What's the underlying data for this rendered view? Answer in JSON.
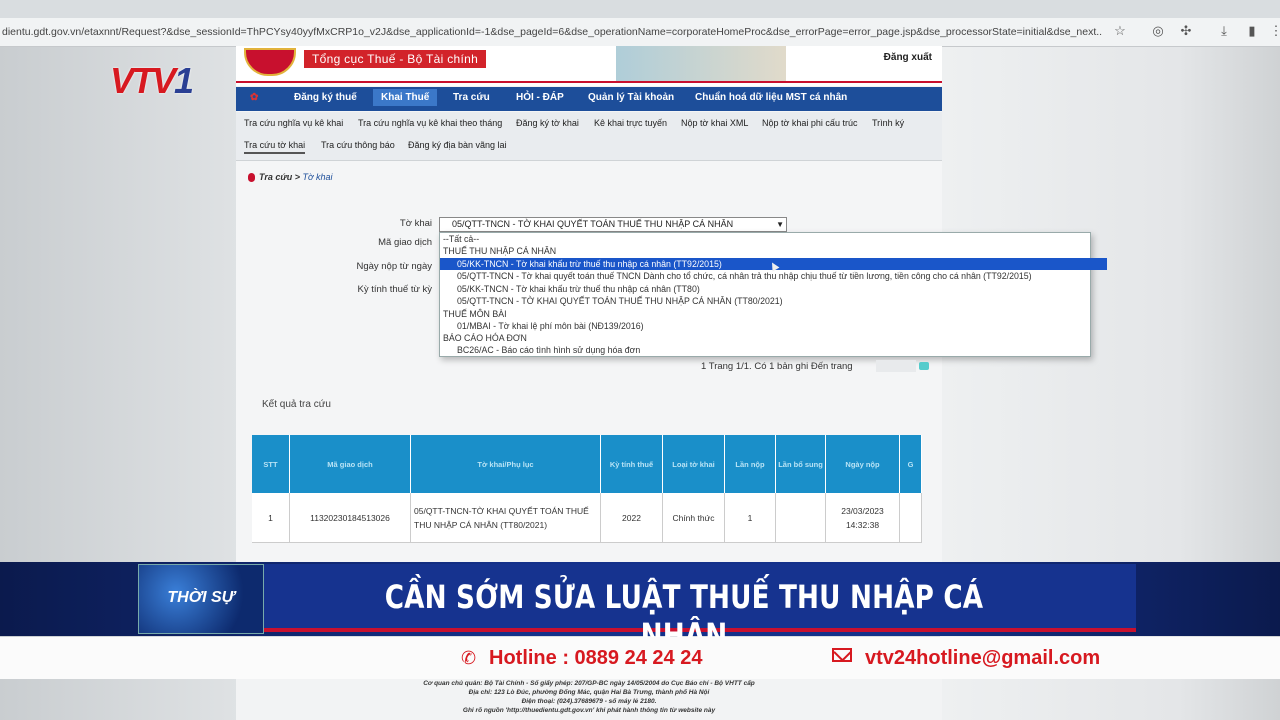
{
  "browser": {
    "url": "dientu.gdt.gov.vn/etaxnnt/Request?&dse_sessionId=ThPCYsy40yyfMxCRP1o_v2J&dse_applicationId=-1&dse_pageId=6&dse_operationName=corporateHomeProc&dse_errorPage=error_page.jsp&dse_processorState=initial&dse_next..."
  },
  "site": {
    "org_name": "Tổng cục Thuế - Bộ Tài chính",
    "logout": "Đăng xuất"
  },
  "nav": {
    "items": [
      {
        "label": "Đăng ký thuế"
      },
      {
        "label": "Khai Thuế"
      },
      {
        "label": "Tra cứu"
      },
      {
        "label": "HỎI - ĐÁP"
      },
      {
        "label": "Quản lý Tài khoản"
      },
      {
        "label": "Chuẩn hoá dữ liệu MST cá nhân"
      }
    ]
  },
  "subnav": {
    "items": [
      {
        "label": "Tra cứu nghĩa vụ kê khai"
      },
      {
        "label": "Tra cứu nghĩa vụ kê khai theo tháng"
      },
      {
        "label": "Đăng ký tờ khai"
      },
      {
        "label": "Kê khai trực tuyến"
      },
      {
        "label": "Nộp tờ khai XML"
      },
      {
        "label": "Nộp tờ khai phi cấu trúc"
      },
      {
        "label": "Trình ký"
      },
      {
        "label": "Tra cứu tờ khai"
      },
      {
        "label": "Tra cứu thông báo"
      },
      {
        "label": "Đăng ký địa bàn vãng lai"
      }
    ]
  },
  "breadcrumb": {
    "root": "Tra cứu",
    "sep": " > ",
    "current": "Tờ khai"
  },
  "form": {
    "labels": {
      "to_khai": "Tờ khai",
      "ma_giao_dich": "Mã giao dịch",
      "ngay_nop": "Ngày nộp từ ngày",
      "ky_tinh_thue": "Kỳ tính thuế từ kỳ"
    },
    "selected": "05/QTT-TNCN - TỜ KHAI QUYẾT TOÁN THUẾ THU NHẬP CÁ NHÂN",
    "options": [
      {
        "text": "--Tất cả--",
        "kind": "grp"
      },
      {
        "text": "THUẾ THU NHẬP CÁ NHÂN",
        "kind": "grp"
      },
      {
        "text": "05/KK-TNCN - Tờ khai khấu trừ thuế thu nhập cá nhân (TT92/2015)",
        "kind": "sel"
      },
      {
        "text": "05/QTT-TNCN - Tờ khai quyết toán thuế TNCN Dành cho tổ chức, cá nhân trả thu nhập chịu thuế từ tiền lương, tiền công cho cá nhân (TT92/2015)",
        "kind": "opt"
      },
      {
        "text": "05/KK-TNCN - Tờ khai khấu trừ thuế thu nhập cá nhân (TT80)",
        "kind": "opt"
      },
      {
        "text": "05/QTT-TNCN - TỜ KHAI QUYẾT TOÁN THUẾ THU NHẬP CÁ NHÂN (TT80/2021)",
        "kind": "opt"
      },
      {
        "text": "THUẾ MÔN BÀI",
        "kind": "grp"
      },
      {
        "text": "01/MBAI - Tờ khai lệ phí môn bài (NĐ139/2016)",
        "kind": "opt"
      },
      {
        "text": "BÁO CÁO HÓA ĐƠN",
        "kind": "grp"
      },
      {
        "text": "BC26/AC - Báo cáo tình hình sử dụng hóa đơn",
        "kind": "opt"
      }
    ]
  },
  "pager": {
    "text": "1  Trang 1/1. Có 1 bản ghi  Đến trang"
  },
  "results": {
    "title": "Kết quả tra cứu",
    "headers": [
      "STT",
      "Mã giao dịch",
      "Tờ khai/Phụ lục",
      "Kỳ tính thuế",
      "Loại tờ khai",
      "Lần nộp",
      "Lần bổ sung",
      "Ngày nộp",
      "G"
    ],
    "rows": [
      [
        "1",
        "11320230184513026",
        "05/QTT-TNCN-TỜ KHAI QUYẾT TOÁN THUẾ THU NHẬP CÁ NHÂN (TT80/2021)",
        "2022",
        "Chính thức",
        "1",
        "",
        "23/03/2023 14:32:38",
        ""
      ]
    ]
  },
  "broadcast": {
    "channel": "VTV",
    "channel_num": "1",
    "tag": "THỜI SỰ",
    "headline": "CẦN SỚM SỬA LUẬT THUẾ THU NHẬP CÁ NHÂN",
    "hotline": "Hotline : 0889 24 24 24",
    "email": "vtv24hotline@gmail.com"
  },
  "footer": {
    "lines": [
      "Cơ quan chủ quản: Bộ Tài Chính - Số giấy phép: 207/GP-BC ngày 14/05/2004 do Cục Báo chí - Bộ VHTT cấp",
      "Địa chỉ: 123 Lò Đúc, phường Đống Mác, quận Hai Bà Trưng, thành phố Hà Nội",
      "Điện thoại: (024).37689679 - số máy lẻ 2180.",
      "Ghi rõ nguồn 'http://thuedientu.gdt.gov.vn' khi phát hành thông tin từ website này"
    ]
  },
  "colors": {
    "nav_bg": "#1d4e9a",
    "table_header": "#1a8fc9",
    "vtv_red": "#d71920",
    "ticker_blue": "#16338f"
  }
}
